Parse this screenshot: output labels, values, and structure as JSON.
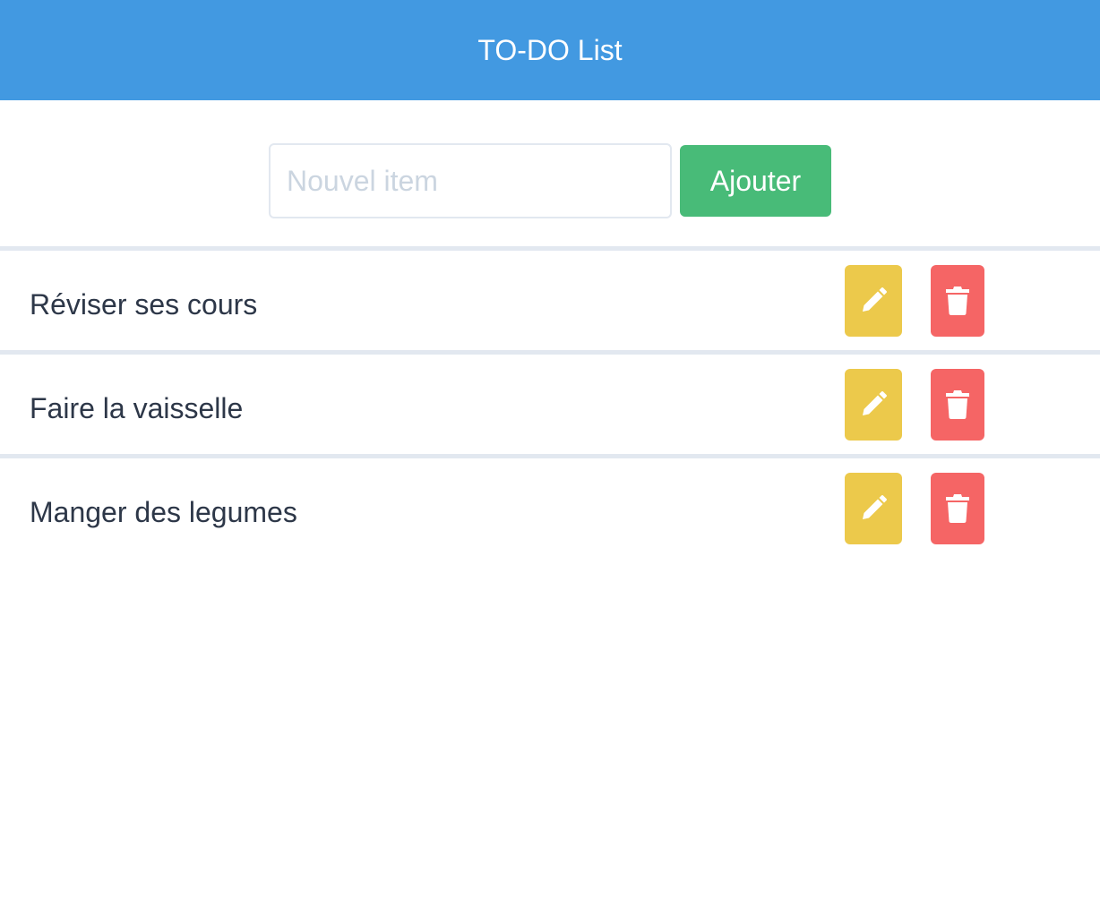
{
  "header": {
    "title": "TO-DO List"
  },
  "form": {
    "placeholder": "Nouvel item",
    "value": "",
    "add_label": "Ajouter"
  },
  "todos": [
    {
      "label": "Réviser ses cours"
    },
    {
      "label": "Faire la vaisselle"
    },
    {
      "label": "Manger des legumes"
    }
  ],
  "icons": {
    "edit": "pencil-icon",
    "delete": "trash-icon"
  },
  "colors": {
    "header": "#4299e1",
    "add_button": "#48bb78",
    "edit_button": "#ecc94b",
    "delete_button": "#f56565",
    "text": "#2d3748",
    "divider": "#e2e8f0"
  }
}
